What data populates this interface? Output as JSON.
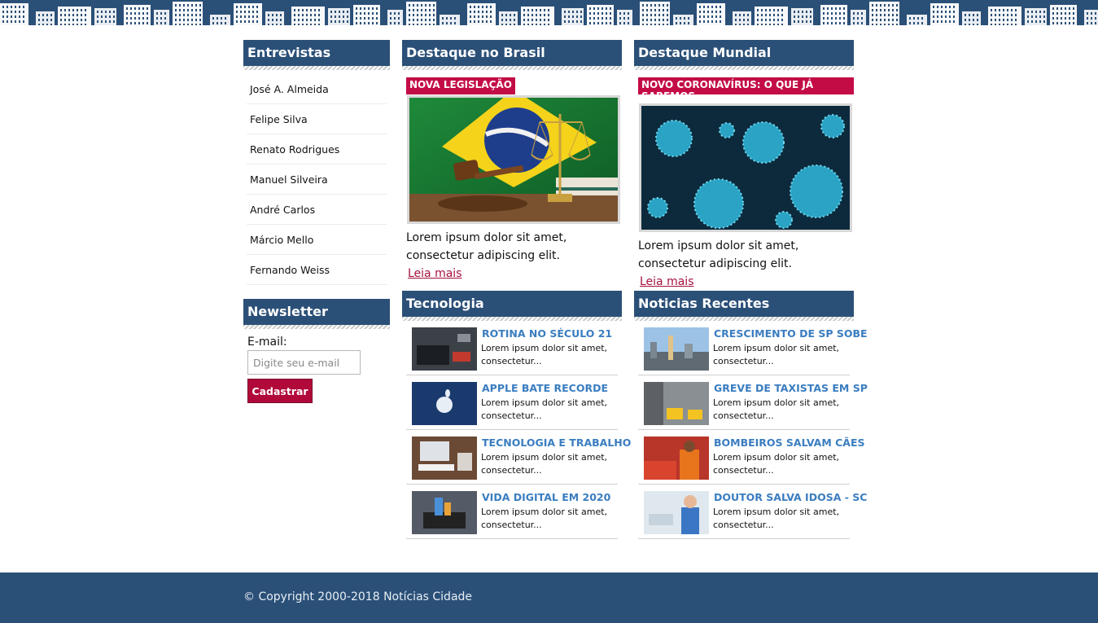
{
  "colors": {
    "header_bg": "#2b5078",
    "accent_red": "#c30c46",
    "title_blue": "#3a7dc0",
    "footer_bg": "#2b5078"
  },
  "entrevistas": {
    "title": "Entrevistas",
    "items": [
      "José A. Almeida",
      "Felipe Silva",
      "Renato Rodrigues",
      "Manuel Silveira",
      "André Carlos",
      "Márcio Mello",
      "Fernando Weiss"
    ]
  },
  "newsletter": {
    "title": "Newsletter",
    "label": "E-mail:",
    "placeholder": "Digite seu e-mail",
    "button": "Cadastrar"
  },
  "destaque_brasil": {
    "title": "Destaque no Brasil",
    "tag": "NOVA LEGISLAÇÃO",
    "image": "brazil-flag-gavel-scales",
    "text": "Lorem ipsum dolor sit amet, consectetur adipiscing elit.",
    "link": "Leia mais"
  },
  "destaque_mundial": {
    "title": "Destaque Mundial",
    "tag": "NOVO CORONAVÍRUS: O QUE JÁ SABEMOS",
    "image": "coronavirus-particles",
    "text": "Lorem ipsum dolor sit amet, consectetur adipiscing elit.",
    "link": "Leia mais"
  },
  "tecnologia": {
    "title": "Tecnologia",
    "items": [
      {
        "title": "ROTINA NO SÉCULO 21",
        "text": "Lorem ipsum dolor sit amet, consectetur...",
        "image": "laptop-desk"
      },
      {
        "title": "APPLE BATE RECORDE",
        "text": "Lorem ipsum dolor sit amet, consectetur...",
        "image": "apple-logo"
      },
      {
        "title": "TECNOLOGIA E TRABALHO",
        "text": "Lorem ipsum dolor sit amet, consectetur...",
        "image": "computer-desk"
      },
      {
        "title": "VIDA DIGITAL EM 2020",
        "text": "Lorem ipsum dolor sit amet, consectetur...",
        "image": "phone-city"
      }
    ]
  },
  "recentes": {
    "title": "Noticias Recentes",
    "items": [
      {
        "title": "CRESCIMENTO DE SP SOBE",
        "text": "Lorem ipsum dolor sit amet, consectetur...",
        "image": "sp-skyline"
      },
      {
        "title": "GREVE DE TAXISTAS EM SP",
        "text": "Lorem ipsum dolor sit amet, consectetur...",
        "image": "taxis-street"
      },
      {
        "title": "BOMBEIROS SALVAM CÃES",
        "text": "Lorem ipsum dolor sit amet, consectetur...",
        "image": "firefighter"
      },
      {
        "title": "DOUTOR SALVA IDOSA - SC",
        "text": "Lorem ipsum dolor sit amet, consectetur...",
        "image": "doctor"
      }
    ]
  },
  "footer": {
    "text": "© Copyright 2000-2018 Notícias Cidade"
  }
}
